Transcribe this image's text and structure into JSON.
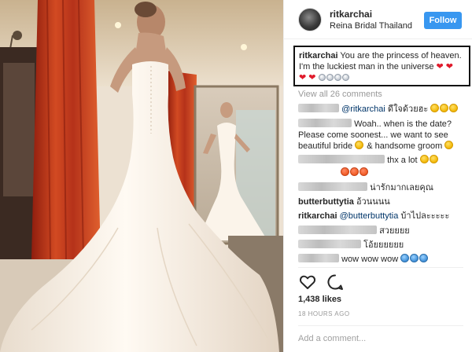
{
  "post": {
    "username": "ritkarchai",
    "location": "Reina Bridal Thailand",
    "follow_label": "Follow",
    "caption_user": "ritkarchai",
    "caption_text": "You are the princess of heaven. I'm the luckiest man in the universe",
    "view_all": "View all 26 comments",
    "likes": "1,438 likes",
    "time": "18 HOURS AGO",
    "add_comment_placeholder": "Add a comment..."
  },
  "comments": [
    {
      "mention": "@ritkarchai",
      "text": "ดีใจด้วยฮะ"
    },
    {
      "text": "Woah.. when is the date? Please come soonest... we want to see beautiful bride",
      "text2": "& handsome groom"
    },
    {
      "text": "thx a lot"
    },
    {
      "text": ""
    },
    {
      "text": "น่ารักมากเลยคุณ"
    },
    {
      "user": "butterbuttytia",
      "text": "อ้วนนนน"
    },
    {
      "user": "ritkarchai",
      "mention": "@butterbuttytia",
      "text": "บ้าไปละะะะะ"
    },
    {
      "text": "สวยยยย"
    },
    {
      "text": "โอ้ยยยยยย"
    },
    {
      "text": "wow wow wow"
    }
  ],
  "icons": {
    "like": "heart-outline-icon",
    "comment": "speech-bubble-icon"
  },
  "colors": {
    "follow_button": "#3897f0",
    "caption_border": "#111111",
    "heart": "#e01b2c",
    "muted_text": "#999999"
  }
}
